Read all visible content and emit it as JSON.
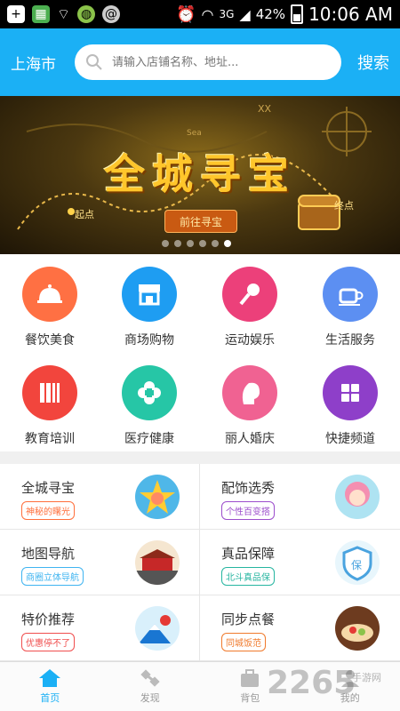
{
  "statusbar": {
    "network": "3G",
    "battery": "42%",
    "time": "10:06 AM"
  },
  "header": {
    "city": "上海市",
    "search_placeholder": "请输入店铺名称、地址...",
    "search_button": "搜索"
  },
  "banner": {
    "title": "全城寻宝",
    "button": "前往寻宝",
    "start": "起点",
    "end": "终点",
    "slides": 6,
    "active_slide": 6
  },
  "categories": [
    {
      "label": "餐饮美食",
      "color": "#ff7043",
      "icon": "food-cloche-icon"
    },
    {
      "label": "商场购物",
      "color": "#1e9df2",
      "icon": "store-icon"
    },
    {
      "label": "运动娱乐",
      "color": "#ec407a",
      "icon": "microphone-icon"
    },
    {
      "label": "生活服务",
      "color": "#5c8ff2",
      "icon": "coffee-cup-icon"
    },
    {
      "label": "教育培训",
      "color": "#f2453d",
      "icon": "books-icon"
    },
    {
      "label": "医疗健康",
      "color": "#26c6a6",
      "icon": "medical-cross-icon"
    },
    {
      "label": "丽人婚庆",
      "color": "#f06292",
      "icon": "woman-profile-icon"
    },
    {
      "label": "快捷频道",
      "color": "#8e3fc9",
      "icon": "grid-icon"
    }
  ],
  "features": [
    {
      "title": "全城寻宝",
      "tag": "神秘的曙光",
      "tag_color": "#ff6f3c"
    },
    {
      "title": "配饰选秀",
      "tag": "个性百变搭",
      "tag_color": "#9c4dcc"
    },
    {
      "title": "地图导航",
      "tag": "商圈立体导航",
      "tag_color": "#3fb4f0"
    },
    {
      "title": "真品保障",
      "tag": "北斗真品保",
      "tag_color": "#26b5a0"
    },
    {
      "title": "特价推荐",
      "tag": "优惠停不了",
      "tag_color": "#f04e4e"
    },
    {
      "title": "同步点餐",
      "tag": "同城饭范",
      "tag_color": "#f07a2c"
    }
  ],
  "nav": [
    {
      "label": "首页",
      "icon": "home-icon",
      "active": true
    },
    {
      "label": "发现",
      "icon": "satellite-icon",
      "active": false
    },
    {
      "label": "背包",
      "icon": "bag-icon",
      "active": false
    },
    {
      "label": "我的",
      "icon": "user-icon",
      "active": false
    }
  ],
  "watermark": {
    "text": "2265",
    "sub": "手游网"
  }
}
